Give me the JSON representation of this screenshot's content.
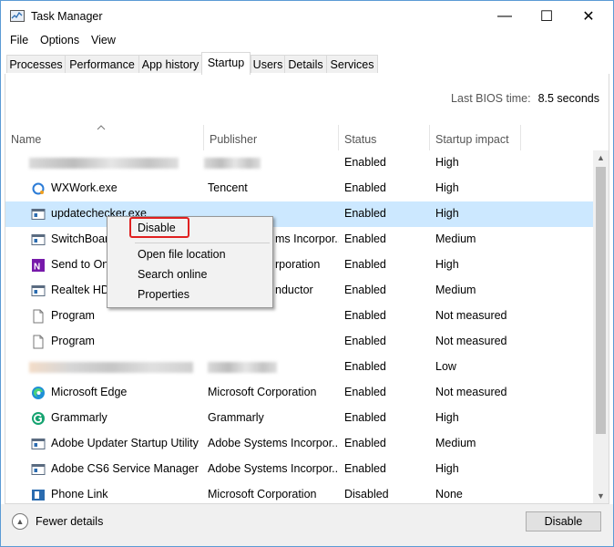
{
  "window": {
    "title": "Task Manager",
    "controls": {
      "minimize": "—",
      "maximize": "☐",
      "close": "✕"
    }
  },
  "menubar": [
    "File",
    "Options",
    "View"
  ],
  "tabs": [
    "Processes",
    "Performance",
    "App history",
    "Startup",
    "Users",
    "Details",
    "Services"
  ],
  "active_tab": "Startup",
  "bios": {
    "label": "Last BIOS time:",
    "value": "8.5 seconds"
  },
  "columns": {
    "name": "Name",
    "publisher": "Publisher",
    "status": "Status",
    "impact": "Startup impact"
  },
  "rows": [
    {
      "name": "",
      "publisher": "",
      "status": "Enabled",
      "impact": "High",
      "icon": "blurred-icon",
      "blurred": true
    },
    {
      "name": "WXWork.exe",
      "publisher": "Tencent",
      "status": "Enabled",
      "impact": "High",
      "icon": "wxwork-icon"
    },
    {
      "name": "updatechecker.exe",
      "publisher": "",
      "status": "Enabled",
      "impact": "High",
      "icon": "app-window-icon",
      "selected": true
    },
    {
      "name": "SwitchBoar",
      "publisher": "ms Incorpor...",
      "status": "Enabled",
      "impact": "Medium",
      "icon": "app-window-icon"
    },
    {
      "name": "Send to One",
      "publisher": "rporation",
      "status": "Enabled",
      "impact": "High",
      "icon": "onenote-icon"
    },
    {
      "name": "Realtek HD",
      "publisher": "nductor",
      "status": "Enabled",
      "impact": "Medium",
      "icon": "app-window-icon"
    },
    {
      "name": "Program",
      "publisher": "",
      "status": "Enabled",
      "impact": "Not measured",
      "icon": "file-icon"
    },
    {
      "name": "Program",
      "publisher": "",
      "status": "Enabled",
      "impact": "Not measured",
      "icon": "file-icon"
    },
    {
      "name": "",
      "publisher": "",
      "status": "Enabled",
      "impact": "Low",
      "icon": "blurred-icon",
      "blurred": true
    },
    {
      "name": "Microsoft Edge",
      "publisher": "Microsoft Corporation",
      "status": "Enabled",
      "impact": "Not measured",
      "icon": "edge-icon"
    },
    {
      "name": "Grammarly",
      "publisher": "Grammarly",
      "status": "Enabled",
      "impact": "High",
      "icon": "grammarly-icon"
    },
    {
      "name": "Adobe Updater Startup Utility",
      "publisher": "Adobe Systems Incorpor...",
      "status": "Enabled",
      "impact": "Medium",
      "icon": "app-window-icon"
    },
    {
      "name": "Adobe CS6 Service Manager",
      "publisher": "Adobe Systems Incorpor...",
      "status": "Enabled",
      "impact": "High",
      "icon": "app-window-icon"
    },
    {
      "name": "Phone Link",
      "publisher": "Microsoft Corporation",
      "status": "Disabled",
      "impact": "None",
      "icon": "phone-link-icon"
    }
  ],
  "context_menu": {
    "items": [
      "Disable",
      "Open file location",
      "Search online",
      "Properties"
    ]
  },
  "footer": {
    "fewer_details": "Fewer details",
    "disable_button": "Disable"
  },
  "colors": {
    "selection": "#cce8ff",
    "highlight_box": "#e02020",
    "window_border": "#5b9bd5"
  }
}
